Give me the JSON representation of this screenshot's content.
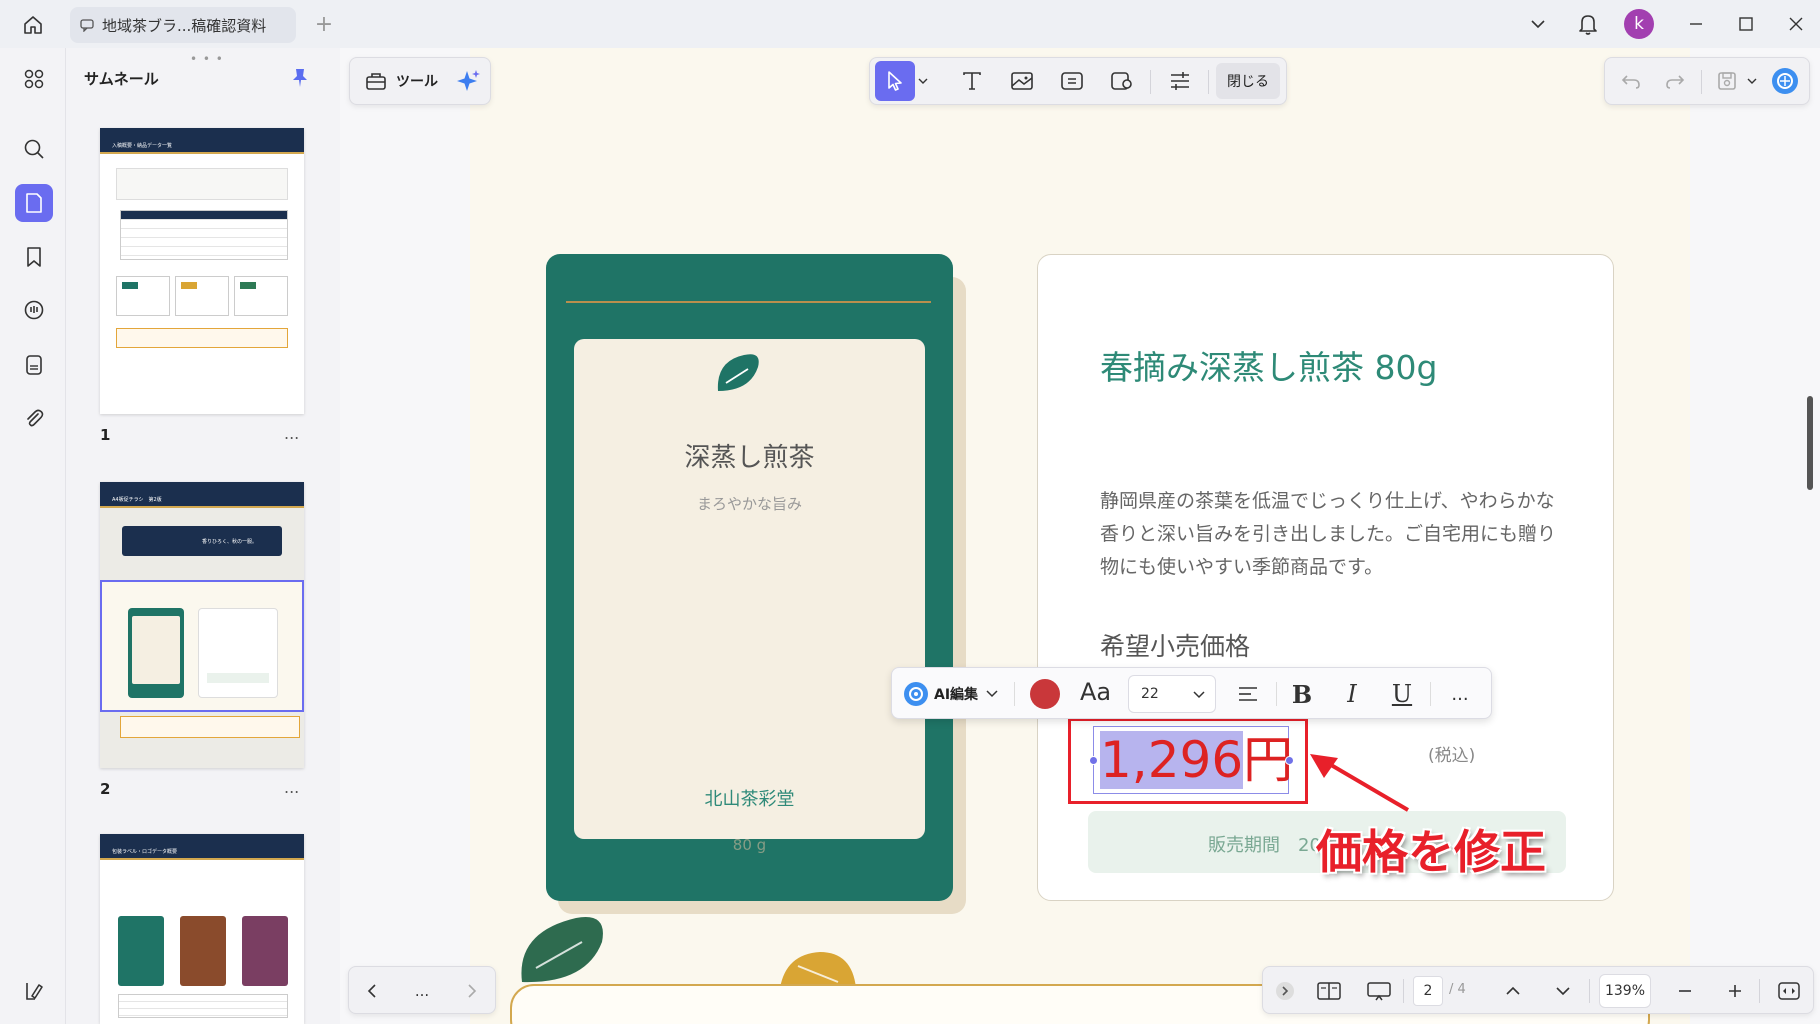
{
  "titlebar": {
    "tab_title": "地域茶ブラ...稿確認資料",
    "avatar_initial": "k"
  },
  "thumbnails": {
    "header": "サムネール",
    "pages": [
      {
        "num": "1",
        "more": "..."
      },
      {
        "num": "2",
        "more": "..."
      }
    ],
    "thumb_texts": {
      "p1_header": "入稿概要・納品データ一覧",
      "p2_header": "A4販促チラシ　第2版",
      "p2_banner": "香りひろく、秋の一服。",
      "p3_header": "包装ラベル・ロゴデータ概要"
    }
  },
  "toolbar": {
    "tools_label": "ツール",
    "close_label": "閉じる"
  },
  "package": {
    "title": "深蒸し煎茶",
    "subtitle": "まろやかな旨み",
    "brand": "北山茶彩堂",
    "weight": "80 g"
  },
  "card": {
    "title": "春摘み深蒸し煎茶 80g",
    "description": "静岡県産の茶葉を低温でじっくり仕上げ、やわらかな香りと深い旨みを引き出しました。ご自宅用にも贈り物にも使いやすい季節商品です。",
    "price_label": "希望小売価格",
    "price_number": "1,296",
    "price_unit": "円",
    "tax_note": "(税込)",
    "period_label": "販売期間　20"
  },
  "format_bar": {
    "ai_label": "AI編集",
    "font_button": "Aa",
    "font_size": "22",
    "bold": "B",
    "italic": "I",
    "underline": "U",
    "more": "...",
    "text_color": "#c9373a"
  },
  "annotation": {
    "text": "価格を修正",
    "color": "#e8202a"
  },
  "bottom": {
    "more": "...",
    "current_page": "2",
    "total_pages": "/ 4",
    "zoom": "139%"
  },
  "colors": {
    "accent": "#6a6cf0",
    "tea_green": "#1f7466",
    "avatar": "#a23fb0"
  }
}
